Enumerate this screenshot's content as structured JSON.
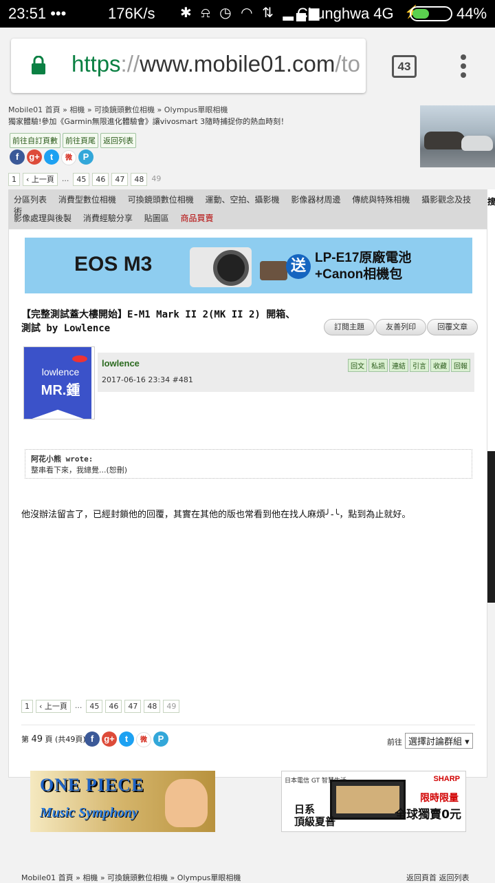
{
  "status_bar": {
    "time": "23:51",
    "dots": "•••",
    "speed": "176K/s",
    "icons": "✱ ⍾ ◷ ◠ ⇅ ▂▄▆",
    "carrier": "Chunghwa 4G",
    "charging": "⚡",
    "battery_level": 0.44,
    "battery": "44%"
  },
  "browser": {
    "url_scheme": "https",
    "url_sep": "://",
    "url_host": "www.mobile01.com",
    "url_path": "/to",
    "tab_count": "43"
  },
  "breadcrumb_top": [
    "Mobile01 首頁",
    "»",
    "相機",
    "»",
    "可換鏡頭數位相機",
    "»",
    "Olympus單眼相機"
  ],
  "promo_text": "獨家體驗!參加《Garmin無限進化體驗會》讓vivosmart 3隨時捕捉你的熱血時刻！",
  "nav_buttons": [
    "前往自訂頁數",
    "前往頁尾",
    "返回列表"
  ],
  "social_icons": [
    {
      "name": "facebook-icon",
      "glyph": "f",
      "color": "#3b5998"
    },
    {
      "name": "google-plus-icon",
      "glyph": "g+",
      "color": "#dd4b39"
    },
    {
      "name": "twitter-icon",
      "glyph": "t",
      "color": "#1da1f2"
    },
    {
      "name": "weibo-icon",
      "glyph": "微",
      "color": "#ffffff"
    },
    {
      "name": "plurk-icon",
      "glyph": "P",
      "color": "#33a7d9"
    }
  ],
  "pagination": {
    "first": "1",
    "prev": "‹ 上一頁",
    "ellipsis": "...",
    "pages": [
      "45",
      "46",
      "47",
      "48"
    ],
    "current": "49"
  },
  "categories_row1": [
    "分區列表",
    "消費型數位相機",
    "可換鏡頭數位相機",
    "運動、空拍、攝影機",
    "影像器材周邊",
    "傳統與特殊相機",
    "攝影觀念及技術"
  ],
  "categories_row2": [
    "影像處理與後製",
    "消費經驗分享",
    "貼圖區"
  ],
  "categories_hot": "商品買賣",
  "right_col_text": "搜",
  "banner": {
    "model": "EOS M3",
    "song": "送",
    "offer_line1": "LP-E17原廠電池",
    "offer_line2": "+Canon相機包"
  },
  "thread_title": "【完整測試蓋大樓開始】E-M1 Mark II 2(MK II 2) 開箱、測試 by Lowlence",
  "thread_actions": [
    "訂閱主題",
    "友善列印",
    "回覆文章"
  ],
  "avatar": {
    "line1": "lowlence",
    "line2": "MR.鍾"
  },
  "post": {
    "username": "lowlence",
    "datetime": "2017-06-16 23:34",
    "floor": "#481",
    "ops": [
      "回文",
      "私訊",
      "連結",
      "引言",
      "收藏",
      "回報"
    ]
  },
  "quote": {
    "author": "阿花小熊 wrote:",
    "text": "整串看下來，我總覺...(恕刪)"
  },
  "post_body": "他沒辦法留言了，已經封鎖他的回覆，其實在其他的版也常看到他在找人麻煩╯-╰，點到為止就好。",
  "page_info": {
    "prefix": "第",
    "page": "49",
    "suffix": "頁 (共49頁)"
  },
  "goto": {
    "label": "前往",
    "select": "選擇討論群組",
    "arrow": "▾"
  },
  "ads": {
    "onepiece_line1": "ONE PIECE",
    "onepiece_line2": "Music Symphony",
    "sharp_brand": "SHARP",
    "sharp_gt": "日本電信 GT 智慧生活",
    "sharp_left": "日系\n頂級夏普",
    "sharp_right1": "限時限量",
    "sharp_right2": "全球獨賣0元"
  },
  "breadcrumb_bottom": [
    "Mobile01 首頁",
    "»",
    "相機",
    "»",
    "可換鏡頭數位相機",
    "»",
    "Olympus單眼相機"
  ],
  "footer_links": [
    "返回頁首",
    "返回列表"
  ]
}
